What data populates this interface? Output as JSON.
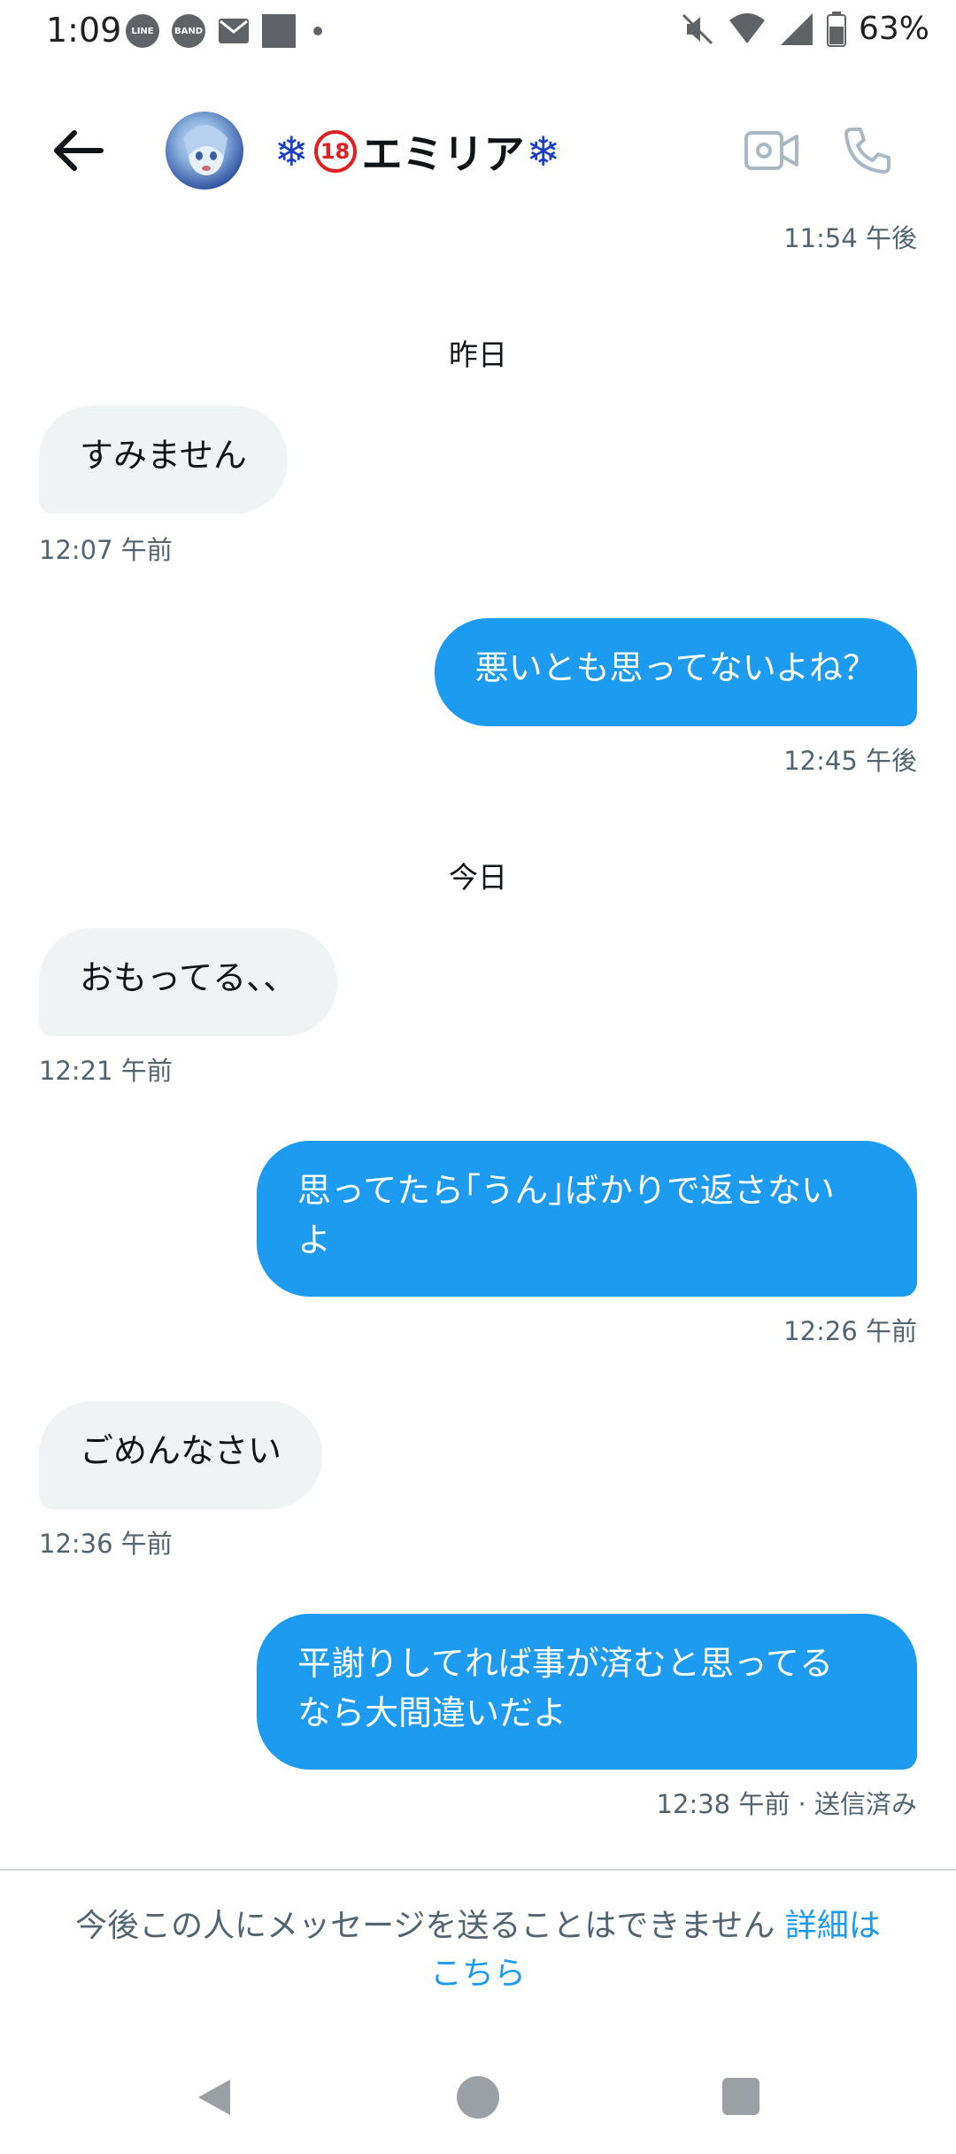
{
  "status_bar": {
    "time": "1:09",
    "line_label": "LINE",
    "band_label": "BAND",
    "battery": "63%",
    "icons": [
      "line-app-icon",
      "band-app-icon",
      "mail-icon",
      "image-icon",
      "dot-icon",
      "mute-icon",
      "wifi-icon",
      "signal-icon",
      "battery-icon"
    ]
  },
  "header": {
    "title_name": "エミリア",
    "badge": "18",
    "flake": "❄"
  },
  "messages": {
    "top_timestamp": "11:54 午後",
    "day_yesterday": "昨日",
    "m1_text": "すみません",
    "m1_time": "12:07 午前",
    "m2_text": "悪いとも思ってないよね？",
    "m2_time": "12:45 午後",
    "day_today": "今日",
    "m3_text": "おもってる、、",
    "m3_time": "12:21 午前",
    "m4_line1": "思ってたら｢うん｣ばかりで返さない",
    "m4_line2": "よ",
    "m4_time": "12:26 午前",
    "m5_text": "ごめんなさい",
    "m5_time": "12:36 午前",
    "m6_line1": "平謝りしてれば事が済むと思ってる",
    "m6_line2": "なら大間違いだよ",
    "m6_time": "12:38 午前 · 送信済み"
  },
  "footer": {
    "notice": "今後この人にメッセージを送ることはできません ",
    "link_line1": "詳細は",
    "link_line2": "こちら"
  },
  "colors": {
    "accent": "#1d9bf0",
    "incoming_bubble": "#eff3f4",
    "timestamp": "#536471"
  }
}
